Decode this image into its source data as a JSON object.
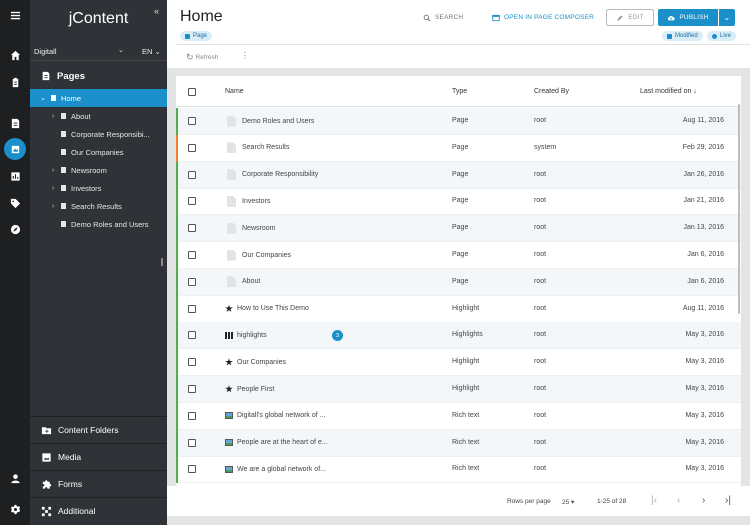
{
  "app": {
    "logo": "jContent"
  },
  "rail": {
    "icons": [
      "menu-icon",
      "home-icon",
      "clipboard-icon",
      "content-icon",
      "pages-icon",
      "chart-icon",
      "tag-icon",
      "compass-icon",
      "user-icon",
      "gear-icon"
    ]
  },
  "sidebar": {
    "site": "Digitall",
    "lang": "EN",
    "pages_label": "Pages",
    "tree": [
      {
        "label": "Home",
        "toggle": "⌄",
        "selected": true
      },
      {
        "label": "About",
        "toggle": "›"
      },
      {
        "label": "Corporate Responsibi...",
        "toggle": ""
      },
      {
        "label": "Our Companies",
        "toggle": ""
      },
      {
        "label": "Newsroom",
        "toggle": "›"
      },
      {
        "label": "Investors",
        "toggle": "›"
      },
      {
        "label": "Search Results",
        "toggle": "›"
      },
      {
        "label": "Demo Roles and Users",
        "toggle": ""
      }
    ],
    "accordions": [
      {
        "label": "Content Folders",
        "icon": "folder-icon"
      },
      {
        "label": "Media",
        "icon": "image-icon"
      },
      {
        "label": "Forms",
        "icon": "puzzle-icon"
      },
      {
        "label": "Additional",
        "icon": "grid-icon"
      }
    ]
  },
  "header": {
    "title": "Home",
    "type_badge": "Page",
    "search_label": "SEARCH",
    "composer_label": "OPEN IN PAGE COMPOSER",
    "edit_label": "EDIT",
    "publish_label": "PUBLISH",
    "status_modified": "Modified",
    "status_live": "Live",
    "refresh_label": "Refresh",
    "more_label": "⋮"
  },
  "colors": {
    "accent": "#1b8fc9",
    "modified": "#4caf50",
    "orange": "#f07d2e",
    "rail": "#1d1f21",
    "sidebar": "#2f3337"
  },
  "table": {
    "columns": {
      "name": "Name",
      "type": "Type",
      "created_by": "Created By",
      "last_modified": "Last modified on ↓"
    },
    "rows": [
      {
        "name": "Demo Roles and Users",
        "type": "Page",
        "created_by": "root",
        "modified": "Aug 11, 2016",
        "icon": "file",
        "status": "green"
      },
      {
        "name": "Search Results",
        "type": "Page",
        "created_by": "system",
        "modified": "Feb 29, 2016",
        "icon": "file",
        "status": "orange"
      },
      {
        "name": "Corporate Responsibility",
        "type": "Page",
        "created_by": "root",
        "modified": "Jan 26, 2016",
        "icon": "file",
        "status": "green"
      },
      {
        "name": "Investors",
        "type": "Page",
        "created_by": "root",
        "modified": "Jan 21, 2016",
        "icon": "file",
        "status": "green"
      },
      {
        "name": "Newsroom",
        "type": "Page",
        "created_by": "root",
        "modified": "Jan 13, 2016",
        "icon": "file",
        "status": "green"
      },
      {
        "name": "Our Companies",
        "type": "Page",
        "created_by": "root",
        "modified": "Jan 6, 2016",
        "icon": "file",
        "status": "green"
      },
      {
        "name": "About",
        "type": "Page",
        "created_by": "root",
        "modified": "Jan 6, 2016",
        "icon": "file",
        "status": "green"
      },
      {
        "name": "How to Use This Demo",
        "type": "Highlight",
        "created_by": "root",
        "modified": "Aug 11, 2016",
        "icon": "star",
        "status": "green"
      },
      {
        "name": "highlights",
        "type": "Highlights",
        "created_by": "root",
        "modified": "May 3, 2016",
        "icon": "grid",
        "status": "green",
        "count": "3"
      },
      {
        "name": "Our Companies",
        "type": "Highlight",
        "created_by": "root",
        "modified": "May 3, 2016",
        "icon": "star",
        "status": "green"
      },
      {
        "name": "People First",
        "type": "Highlight",
        "created_by": "root",
        "modified": "May 3, 2016",
        "icon": "star",
        "status": "green"
      },
      {
        "name": "Digitall's global network of ...",
        "type": "Rich text",
        "created_by": "root",
        "modified": "May 3, 2016",
        "icon": "richtext",
        "status": "green"
      },
      {
        "name": "People are at the heart of e...",
        "type": "Rich text",
        "created_by": "root",
        "modified": "May 3, 2016",
        "icon": "richtext",
        "status": "green"
      },
      {
        "name": "We are a global network of...",
        "type": "Rich text",
        "created_by": "root",
        "modified": "May 3, 2016",
        "icon": "richtext",
        "status": "green"
      }
    ]
  },
  "pager": {
    "rows_per_page_label": "Rows per page",
    "rows_per_page_value": "25",
    "range": "1-25 of 28",
    "first": "|‹",
    "prev": "‹",
    "next": "›",
    "last": "›|"
  }
}
